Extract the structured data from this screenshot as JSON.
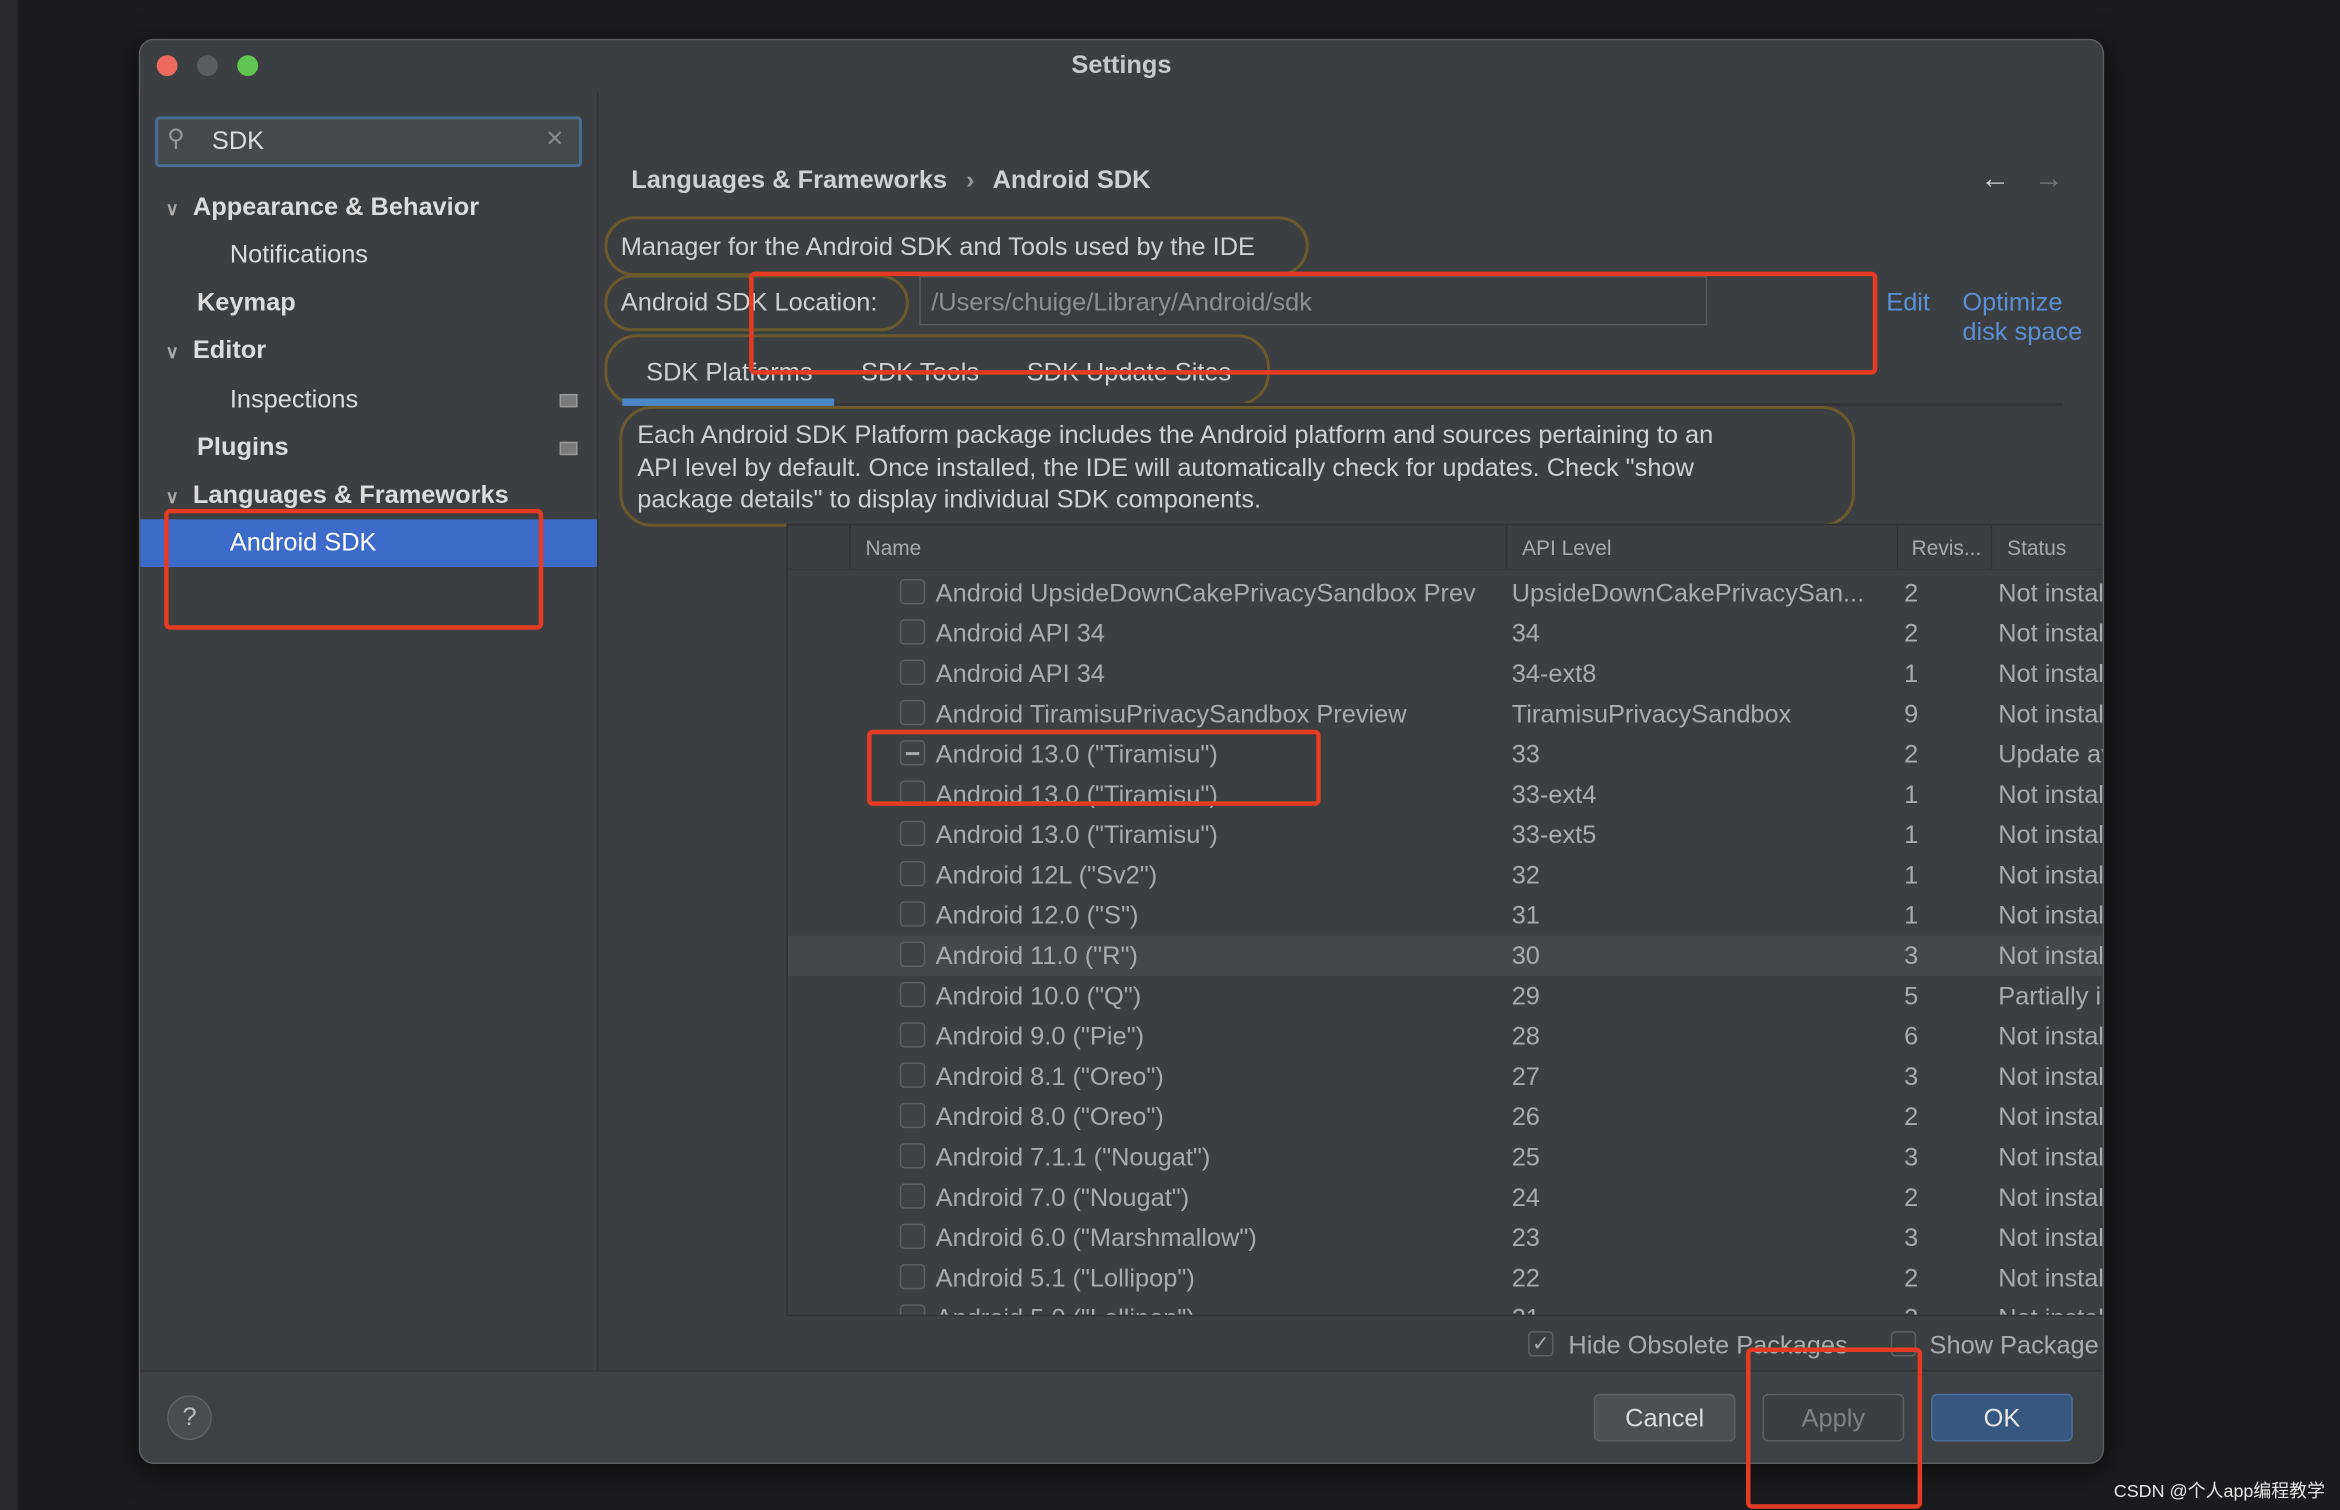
{
  "window": {
    "title": "Settings"
  },
  "sidebar": {
    "search_value": "SDK",
    "items": [
      {
        "label": "Appearance & Behavior"
      },
      {
        "label": "Notifications"
      },
      {
        "label": "Keymap"
      },
      {
        "label": "Editor"
      },
      {
        "label": "Inspections"
      },
      {
        "label": "Plugins"
      },
      {
        "label": "Languages & Frameworks"
      },
      {
        "label": "Android SDK"
      }
    ]
  },
  "header": {
    "breadcrumb_parent": "Languages & Frameworks",
    "separator": "›",
    "breadcrumb_current": "Android SDK",
    "back": "←",
    "forward": "→"
  },
  "main": {
    "description": "Manager for the Android SDK and Tools used by the IDE",
    "sdk_location_label": "Android SDK Location:",
    "sdk_location_value": "/Users/chuige/Library/Android/sdk",
    "edit_link": "Edit",
    "optimize_link": "Optimize disk space",
    "tabs": [
      {
        "label": "SDK Platforms"
      },
      {
        "label": "SDK Tools"
      },
      {
        "label": "SDK Update Sites"
      }
    ],
    "info_lines": [
      "Each Android SDK Platform package includes the Android platform and sources pertaining to an",
      "API level by default. Once installed, the IDE will automatically check for updates. Check \"show",
      "package details\" to display individual SDK components."
    ],
    "table": {
      "columns": [
        "Name",
        "API Level",
        "Revis...",
        "Status"
      ],
      "rows": [
        {
          "name": "Android UpsideDownCakePrivacySandbox Prev",
          "api": "UpsideDownCakePrivacySan...",
          "rev": "2",
          "status": "Not installed",
          "state": "unchecked"
        },
        {
          "name": "Android API 34",
          "api": "34",
          "rev": "2",
          "status": "Not installed",
          "state": "unchecked"
        },
        {
          "name": "Android API 34",
          "api": "34-ext8",
          "rev": "1",
          "status": "Not installed",
          "state": "unchecked"
        },
        {
          "name": "Android TiramisuPrivacySandbox Preview",
          "api": "TiramisuPrivacySandbox",
          "rev": "9",
          "status": "Not installed",
          "state": "unchecked"
        },
        {
          "name": "Android 13.0 (\"Tiramisu\")",
          "api": "33",
          "rev": "2",
          "status": "Update availa...",
          "state": "partial"
        },
        {
          "name": "Android 13.0 (\"Tiramisu\")",
          "api": "33-ext4",
          "rev": "1",
          "status": "Not installed",
          "state": "unchecked"
        },
        {
          "name": "Android 13.0 (\"Tiramisu\")",
          "api": "33-ext5",
          "rev": "1",
          "status": "Not installed",
          "state": "unchecked"
        },
        {
          "name": "Android 12L (\"Sv2\")",
          "api": "32",
          "rev": "1",
          "status": "Not installed",
          "state": "unchecked"
        },
        {
          "name": "Android 12.0 (\"S\")",
          "api": "31",
          "rev": "1",
          "status": "Not installed",
          "state": "unchecked"
        },
        {
          "name": "Android 11.0 (\"R\")",
          "api": "30",
          "rev": "3",
          "status": "Not installed",
          "state": "unchecked",
          "hover": true
        },
        {
          "name": "Android 10.0 (\"Q\")",
          "api": "29",
          "rev": "5",
          "status": "Partially instal...",
          "state": "unchecked"
        },
        {
          "name": "Android 9.0 (\"Pie\")",
          "api": "28",
          "rev": "6",
          "status": "Not installed",
          "state": "unchecked"
        },
        {
          "name": "Android 8.1 (\"Oreo\")",
          "api": "27",
          "rev": "3",
          "status": "Not installed",
          "state": "unchecked"
        },
        {
          "name": "Android 8.0 (\"Oreo\")",
          "api": "26",
          "rev": "2",
          "status": "Not installed",
          "state": "unchecked"
        },
        {
          "name": "Android 7.1.1 (\"Nougat\")",
          "api": "25",
          "rev": "3",
          "status": "Not installed",
          "state": "unchecked"
        },
        {
          "name": "Android 7.0 (\"Nougat\")",
          "api": "24",
          "rev": "2",
          "status": "Not installed",
          "state": "unchecked"
        },
        {
          "name": "Android 6.0 (\"Marshmallow\")",
          "api": "23",
          "rev": "3",
          "status": "Not installed",
          "state": "unchecked"
        },
        {
          "name": "Android 5.1 (\"Lollipop\")",
          "api": "22",
          "rev": "2",
          "status": "Not installed",
          "state": "unchecked"
        },
        {
          "name": "Android 5.0 (\"Lollipop\")",
          "api": "21",
          "rev": "2",
          "status": "Not installed",
          "state": "unchecked"
        }
      ]
    },
    "hide_obsolete": {
      "label": "Hide Obsolete Packages",
      "checked": true
    },
    "show_details": {
      "label": "Show Package Details",
      "checked": false
    }
  },
  "footer": {
    "help": "?",
    "cancel": "Cancel",
    "apply": "Apply",
    "ok": "OK"
  },
  "watermark": "CSDN @个人app编程教学",
  "colors": {
    "accent": "#3d6bc9",
    "annotation_red": "#e53a24",
    "link": "#5b8fd6",
    "ok_button": "#365880"
  }
}
